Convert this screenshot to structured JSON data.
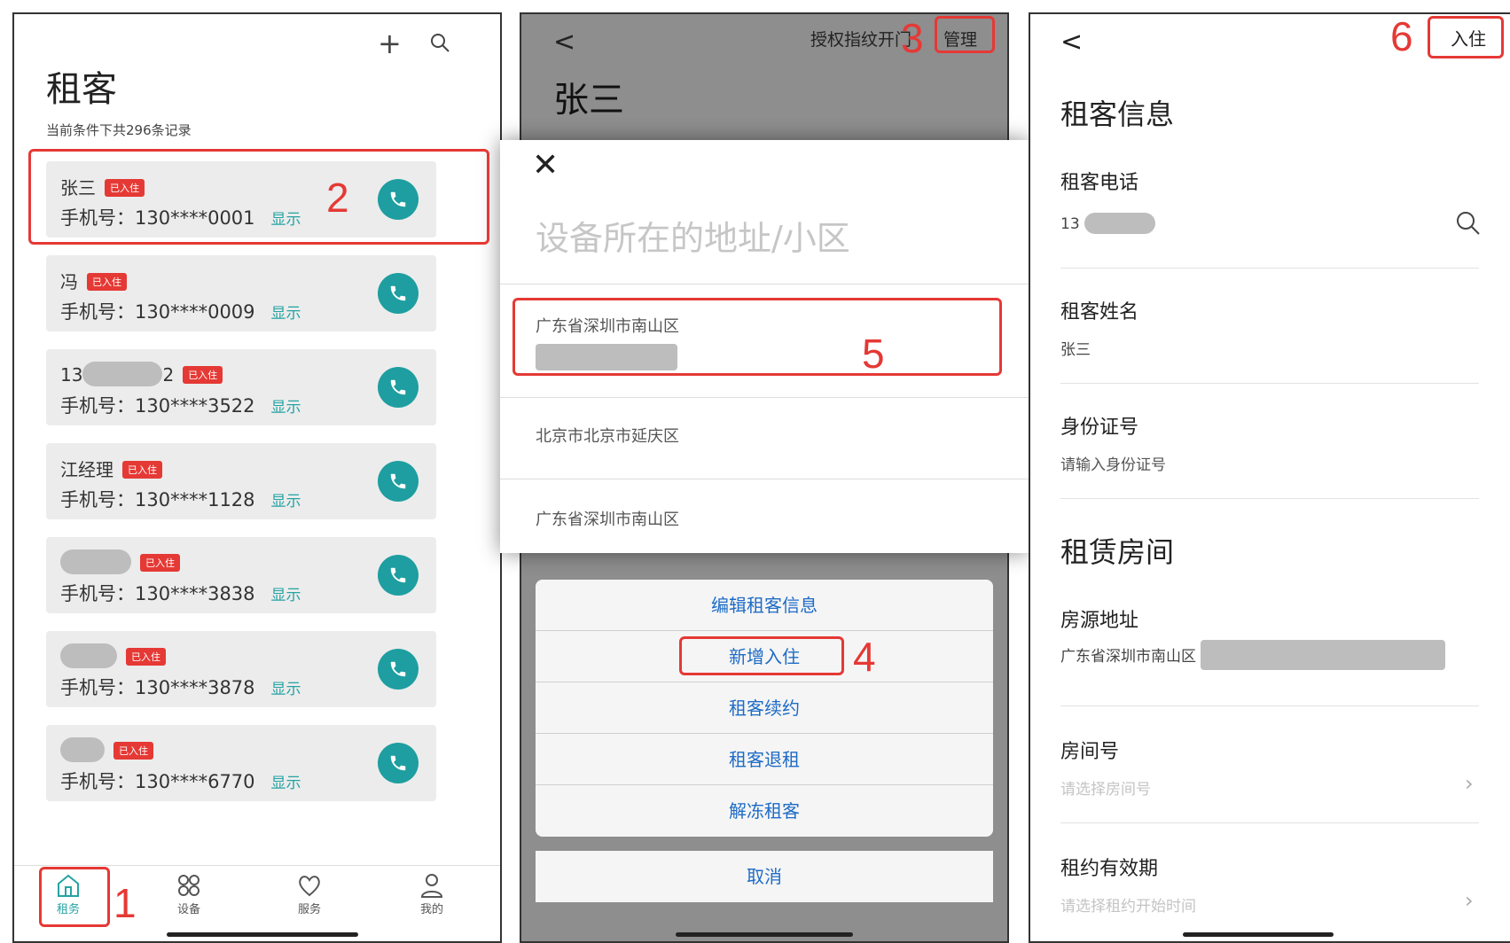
{
  "panel1": {
    "title": "租客",
    "count_text": "当前条件下共296条记录",
    "show_label": "显示",
    "badge": "已入住",
    "tenants": [
      {
        "name": "张三",
        "phone": "手机号：130****0001"
      },
      {
        "name": "冯",
        "phone": "手机号：130****0009"
      },
      {
        "name": "13",
        "name_suffix": "2",
        "phone": "手机号：130****3522"
      },
      {
        "name": "江经理",
        "phone": "手机号：130****1128"
      },
      {
        "name": "",
        "phone": "手机号：130****3838"
      },
      {
        "name": "",
        "phone": "手机号：130****3878"
      },
      {
        "name": "",
        "phone": "手机号：130****6770"
      }
    ],
    "nav": [
      {
        "label": "租务",
        "icon": "house-icon"
      },
      {
        "label": "设备",
        "icon": "grid-icon"
      },
      {
        "label": "服务",
        "icon": "heart-icon"
      },
      {
        "label": "我的",
        "icon": "person-icon"
      }
    ]
  },
  "panel2": {
    "back": "<",
    "auth_text": "授权指纹开门",
    "manage_label": "管理",
    "tenant_name": "张三",
    "actions": [
      "编辑租客信息",
      "新增入住",
      "租客续约",
      "租客退租",
      "解冻租客"
    ],
    "cancel_label": "取消"
  },
  "dialog": {
    "close": "✕",
    "placeholder": "设备所在的地址/小区",
    "addresses": [
      "广东省深圳市南山区",
      "北京市北京市延庆区",
      "广东省深圳市南山区"
    ]
  },
  "panel3": {
    "back": "<",
    "checkin_label": "入住",
    "section1": "租客信息",
    "phone_label": "租客电话",
    "phone_value": "13",
    "name_label": "租客姓名",
    "name_value": "张三",
    "id_label": "身份证号",
    "id_placeholder": "请输入身份证号",
    "section2": "租赁房间",
    "address_label": "房源地址",
    "address_value": "广东省深圳市南山区",
    "room_label": "房间号",
    "room_placeholder": "请选择房间号",
    "term_label": "租约有效期",
    "term_placeholder": "请选择租约开始时间"
  },
  "steps": [
    "1",
    "2",
    "3",
    "4",
    "5",
    "6"
  ],
  "colors": {
    "accent": "#1e9ea0",
    "badge": "#e53935",
    "annotation": "#e53935",
    "action_text": "#1e6bc6"
  }
}
